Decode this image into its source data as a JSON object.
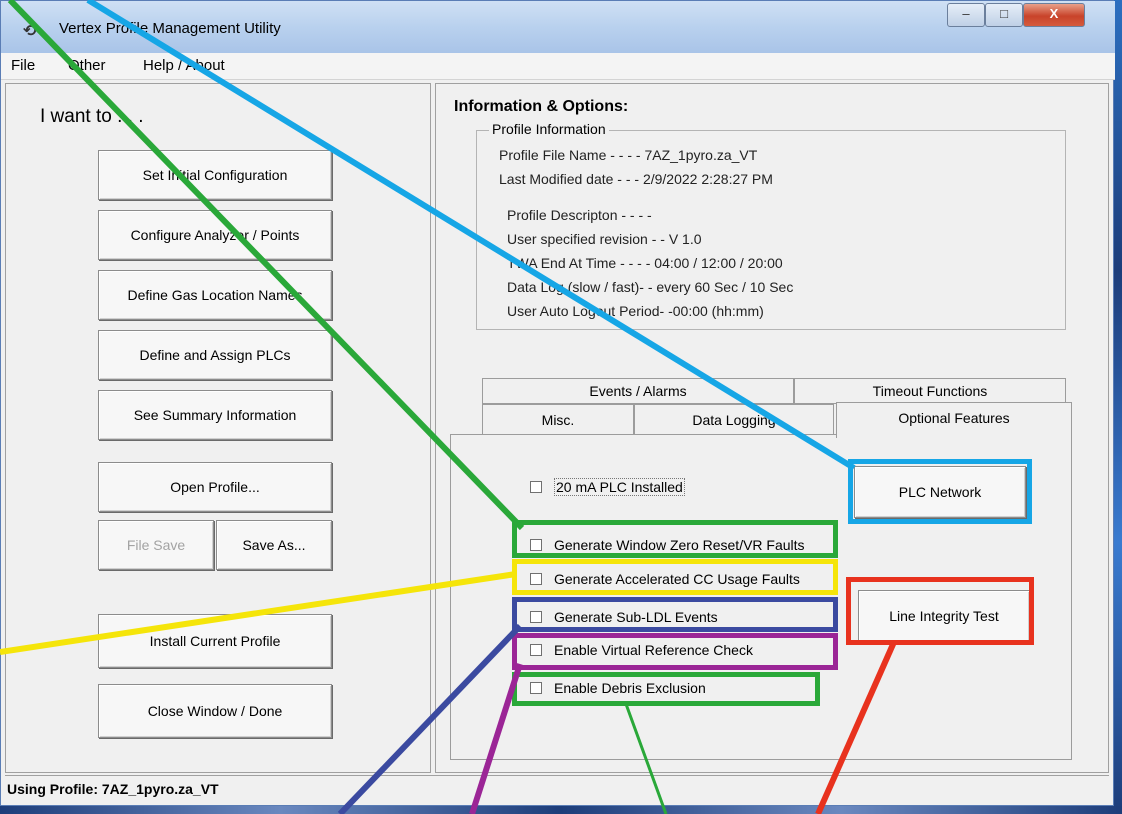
{
  "window": {
    "title": "Vertex Profile Management Utility",
    "controls": {
      "minimize": "–",
      "maximize": "□",
      "close": "X"
    }
  },
  "menu": {
    "file": "File",
    "other": "Other",
    "help": "Help / About"
  },
  "left": {
    "heading": "I want to . . .",
    "buttons": {
      "set_initial": "Set Initial Configuration",
      "configure_analyzer": "Configure Analyzer / Points",
      "define_gas": "Define Gas Location Names",
      "define_plcs": "Define and Assign PLCs",
      "summary": "See Summary Information",
      "open_profile": "Open Profile...",
      "file_save": "File Save",
      "save_as": "Save As...",
      "install_current": "Install Current Profile",
      "close_window": "Close Window / Done"
    }
  },
  "info": {
    "heading": "Information & Options:",
    "group_title": "Profile Information",
    "lines": {
      "file_name": "Profile File Name - - - -  7AZ_1pyro.za_VT",
      "last_modified": "Last Modified date - - -  2/9/2022 2:28:27 PM",
      "description": "Profile Descripton - - - -",
      "revision": "User specified revision - - V 1.0",
      "twa": "TWA End At Time  - - - -  04:00  /  12:00  /  20:00",
      "data_log": "Data  Log (slow / fast)-  - every 60 Sec / 10 Sec",
      "logout": "User Auto Logout Period-  -00:00 (hh:mm)"
    }
  },
  "tabs": {
    "events_alarms": "Events / Alarms",
    "timeout_functions": "Timeout Functions",
    "misc": "Misc.",
    "data_logging": "Data Logging",
    "optional_features": "Optional Features"
  },
  "options": {
    "plc_installed": "20 mA PLC Installed",
    "window_zero": "Generate Window Zero Reset/VR Faults",
    "accelerated_cc": "Generate Accelerated CC Usage Faults",
    "sub_ldl": "Generate Sub-LDL Events",
    "virtual_ref": "Enable Virtual Reference Check",
    "debris": "Enable Debris Exclusion",
    "plc_network": "PLC Network",
    "line_integrity": "Line Integrity Test"
  },
  "status": {
    "using_profile": "Using Profile:  7AZ_1pyro.za_VT"
  },
  "colors": {
    "green": "#2aa839",
    "cyan": "#16a6e6",
    "yellow": "#f5e50a",
    "navy": "#3b4aa0",
    "purple": "#9b2596",
    "red": "#e8321e"
  }
}
